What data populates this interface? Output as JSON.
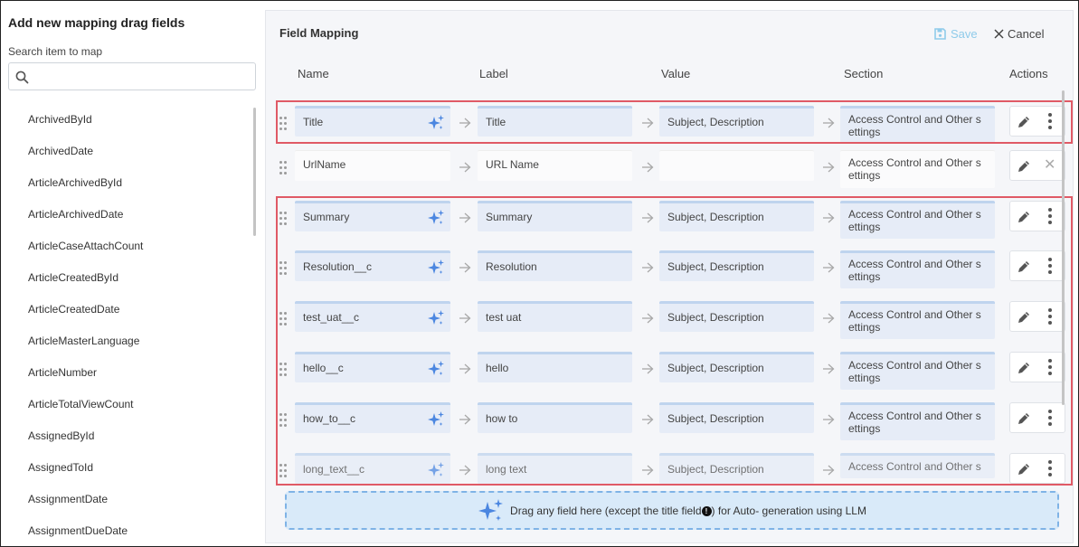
{
  "left_panel": {
    "title": "Add new mapping drag fields",
    "search_label": "Search item to map",
    "search_placeholder": "",
    "fields": [
      "ArchivedById",
      "ArchivedDate",
      "ArticleArchivedById",
      "ArticleArchivedDate",
      "ArticleCaseAttachCount",
      "ArticleCreatedById",
      "ArticleCreatedDate",
      "ArticleMasterLanguage",
      "ArticleNumber",
      "ArticleTotalViewCount",
      "AssignedById",
      "AssignedToId",
      "AssignmentDate",
      "AssignmentDueDate"
    ]
  },
  "mapping": {
    "title": "Field Mapping",
    "save_label": "Save",
    "cancel_label": "Cancel",
    "columns": {
      "name": "Name",
      "label": "Label",
      "value": "Value",
      "section": "Section",
      "actions": "Actions"
    },
    "rows": [
      {
        "name": "Title",
        "label": "Title",
        "value": "Subject, Description",
        "section": "Access Control and Other s ettings"
      },
      {
        "name": "UrlName",
        "label": "URL Name",
        "value": "",
        "section": "Access Control and Other s ettings"
      },
      {
        "name": "Summary",
        "label": "Summary",
        "value": "Subject, Description",
        "section": "Access Control and Other s ettings"
      },
      {
        "name": "Resolution__c",
        "label": "Resolution",
        "value": "Subject, Description",
        "section": "Access Control and Other s ettings"
      },
      {
        "name": "test_uat__c",
        "label": "test uat",
        "value": "Subject, Description",
        "section": "Access Control and Other s ettings"
      },
      {
        "name": "hello__c",
        "label": "hello",
        "value": "Subject, Description",
        "section": "Access Control and Other s ettings"
      },
      {
        "name": "how_to__c",
        "label": "how to",
        "value": "Subject, Description",
        "section": "Access Control and Other s ettings"
      },
      {
        "name": "long_text__c",
        "label": "long text",
        "value": "Subject, Description",
        "section": "Access Control and Other s"
      }
    ],
    "dropzone_text_before": "Drag any field here (except the title field",
    "dropzone_text_after": ") for Auto- generation using LLM",
    "dropzone_info": "!"
  },
  "colors": {
    "highlight_border": "#e05a66",
    "cell_bg": "#e6ecf7",
    "spark": "#4b86e0",
    "save": "#8fcbea"
  }
}
